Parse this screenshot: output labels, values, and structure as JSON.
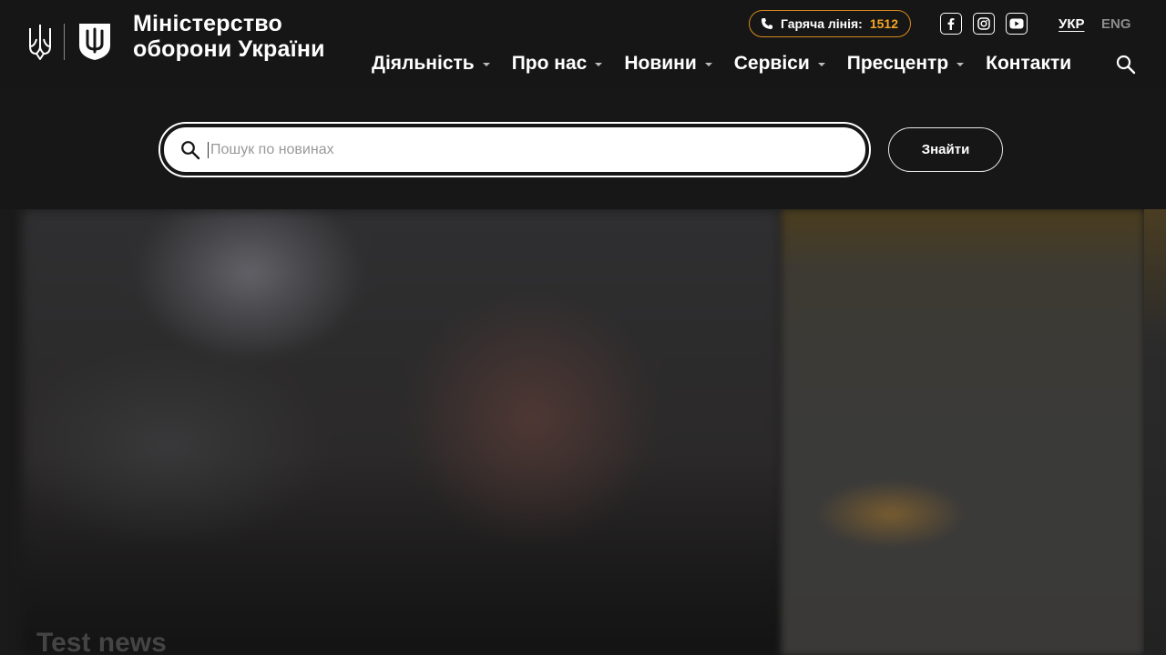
{
  "header": {
    "ministry_name": "Міністерство оборони України",
    "hotline": {
      "label": "Гаряча лінія:",
      "number": "1512"
    },
    "social": [
      "facebook-icon",
      "instagram-icon",
      "youtube-icon"
    ],
    "languages": [
      {
        "label": "УКР",
        "active": true
      },
      {
        "label": "ENG",
        "active": false
      }
    ],
    "nav": [
      {
        "label": "Діяльність",
        "has_dropdown": true
      },
      {
        "label": "Про нас",
        "has_dropdown": true
      },
      {
        "label": "Новини",
        "has_dropdown": true
      },
      {
        "label": "Сервіси",
        "has_dropdown": true
      },
      {
        "label": "Пресцентр",
        "has_dropdown": true
      },
      {
        "label": "Контакти",
        "has_dropdown": false
      }
    ]
  },
  "search": {
    "placeholder": "Пошук по новинах",
    "value": "",
    "button_label": "Знайти"
  },
  "hero": {
    "title": "Test news"
  },
  "colors": {
    "background": "#161616",
    "accent": "#f5a623",
    "hotline_border": "#d98a1e",
    "text": "#ffffff"
  }
}
